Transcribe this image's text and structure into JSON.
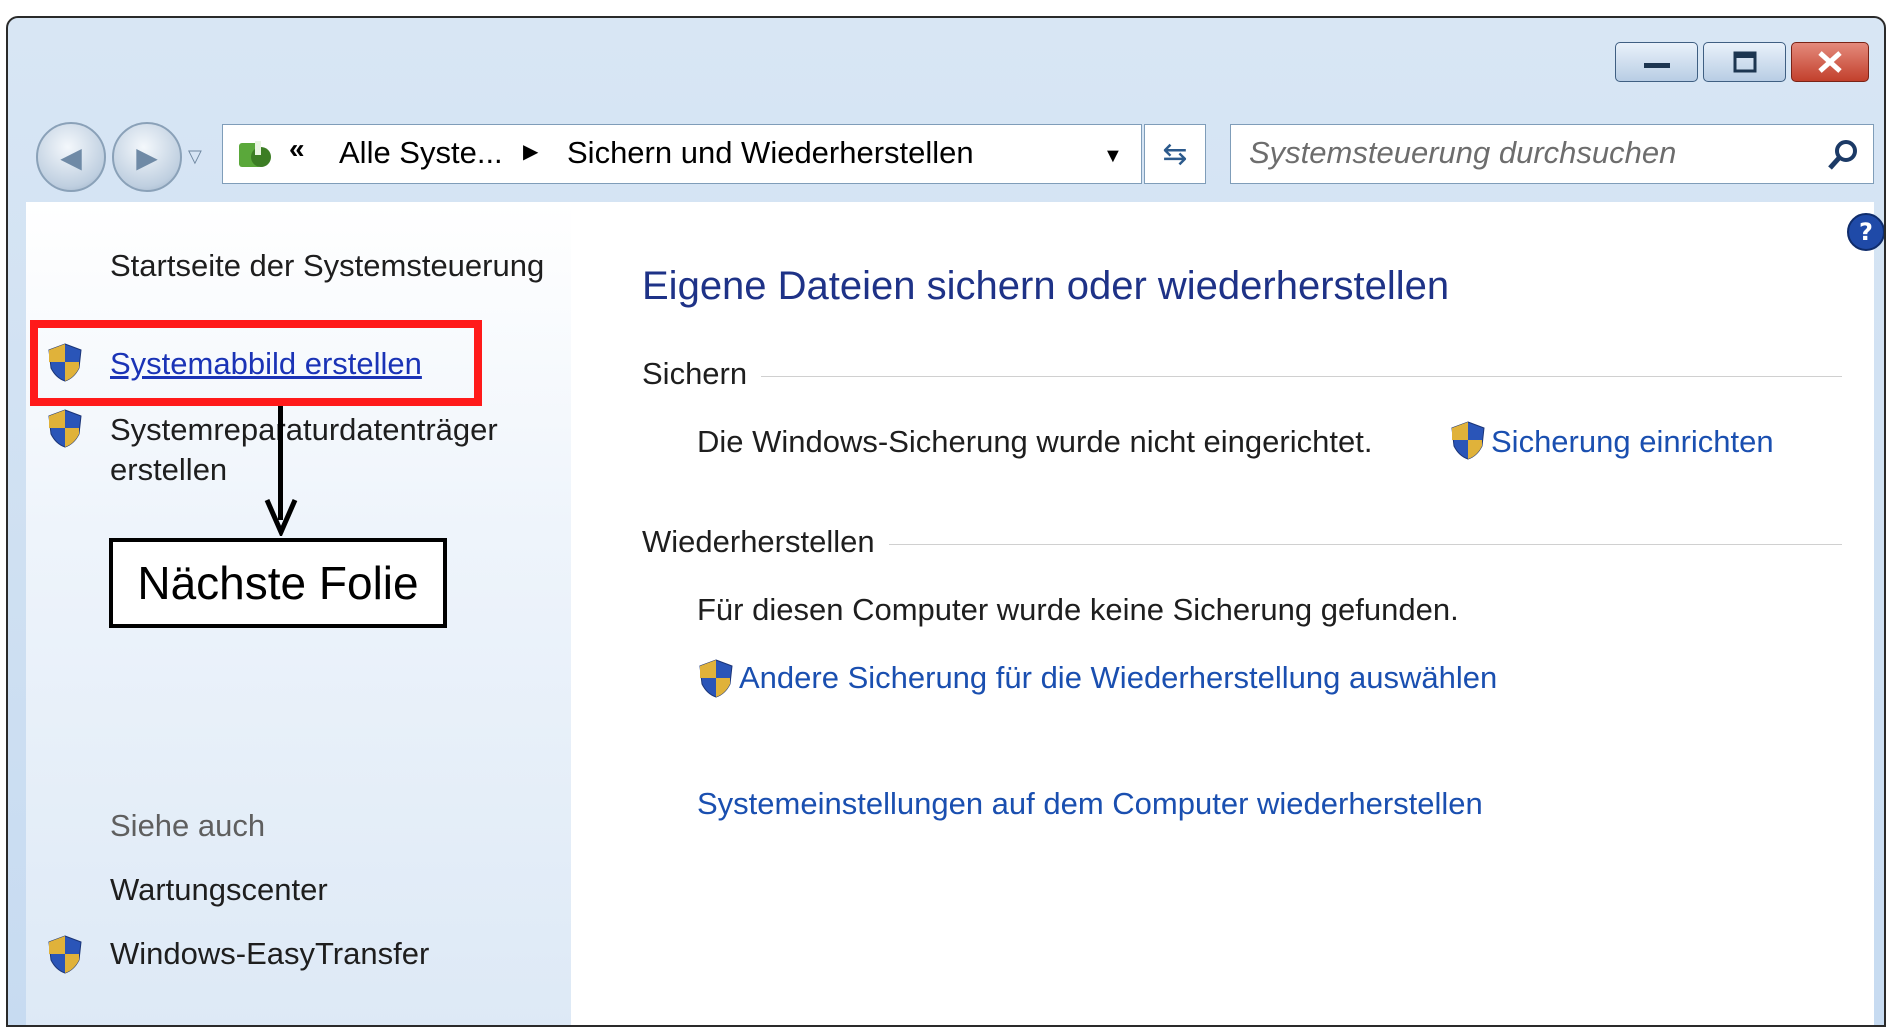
{
  "window": {
    "caption_buttons": {
      "minimize_icon": "minimize-icon",
      "maximize_icon": "maximize-icon",
      "close_icon": "close-icon"
    }
  },
  "address_bar": {
    "overflow_chevron": "«",
    "crumbs": [
      "Alle Syste...",
      "Sichern und Wiederherstellen"
    ]
  },
  "search": {
    "placeholder": "Systemsteuerung durchsuchen"
  },
  "sidebar": {
    "home_link": "Startseite der Systemsteuerung",
    "tasks": [
      {
        "label": "Systemabbild erstellen",
        "icon": "uac-shield-icon"
      },
      {
        "label": "Systemreparaturdatenträger erstellen",
        "icon": "uac-shield-icon"
      }
    ],
    "see_also_title": "Siehe auch",
    "see_also": [
      {
        "label": "Wartungscenter"
      },
      {
        "label": "Windows-EasyTransfer",
        "icon": "uac-shield-icon"
      }
    ]
  },
  "main": {
    "title": "Eigene Dateien sichern oder wiederherstellen",
    "backup": {
      "heading": "Sichern",
      "status": "Die Windows-Sicherung wurde nicht eingerichtet.",
      "setup_link": "Sicherung einrichten"
    },
    "restore": {
      "heading": "Wiederherstellen",
      "status": "Für diesen Computer wurde keine Sicherung gefunden.",
      "other_backup_link": "Andere Sicherung für die Wiederherstellung auswählen",
      "system_restore_link": "Systemeinstellungen auf dem Computer wiederherstellen"
    }
  },
  "annotation": {
    "label": "Nächste Folie",
    "highlight_color": "#ff1a1a"
  },
  "colors": {
    "link": "#1a4fb0",
    "title": "#1e3287",
    "frame": "#c7dbf1"
  }
}
